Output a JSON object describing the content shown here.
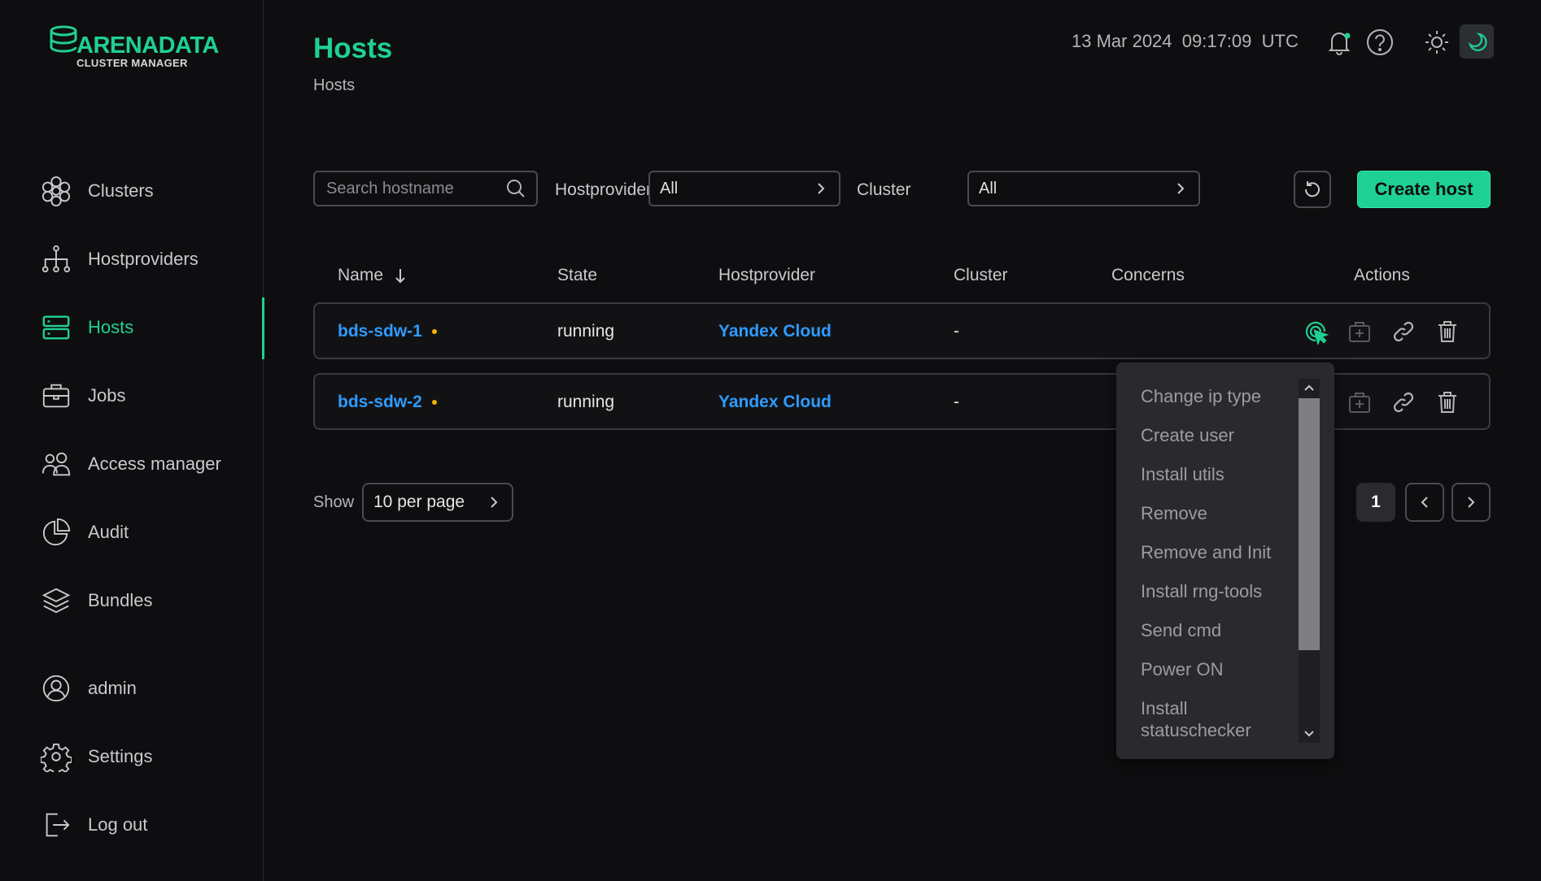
{
  "brand": {
    "name": "ARENADATA",
    "subtitle": "CLUSTER MANAGER",
    "accent": "#1fd095"
  },
  "sidebar": {
    "items": [
      {
        "label": "Clusters",
        "icon": "clusters-icon"
      },
      {
        "label": "Hostproviders",
        "icon": "hierarchy-icon"
      },
      {
        "label": "Hosts",
        "icon": "server-icon",
        "active": true
      },
      {
        "label": "Jobs",
        "icon": "briefcase-icon"
      },
      {
        "label": "Access manager",
        "icon": "users-icon"
      },
      {
        "label": "Audit",
        "icon": "pie-chart-icon"
      },
      {
        "label": "Bundles",
        "icon": "layers-icon"
      }
    ],
    "bottom": [
      {
        "label": "admin",
        "icon": "user-icon"
      },
      {
        "label": "Settings",
        "icon": "gear-icon"
      },
      {
        "label": "Log out",
        "icon": "logout-icon"
      }
    ]
  },
  "header": {
    "title": "Hosts",
    "breadcrumb": "Hosts",
    "date": "13 Mar 2024",
    "time": "09:17:09",
    "timezone": "UTC"
  },
  "filters": {
    "search_placeholder": "Search hostname",
    "hostprovider_label": "Hostprovider",
    "hostprovider_value": "All",
    "cluster_label": "Cluster",
    "cluster_value": "All",
    "create_label": "Create host"
  },
  "table": {
    "columns": [
      "Name",
      "State",
      "Hostprovider",
      "Cluster",
      "Concerns",
      "Actions"
    ],
    "rows": [
      {
        "name": "bds-sdw-1",
        "state": "running",
        "hostprovider": "Yandex Cloud",
        "cluster": "-"
      },
      {
        "name": "bds-sdw-2",
        "state": "running",
        "hostprovider": "Yandex Cloud",
        "cluster": "-"
      }
    ]
  },
  "pagination": {
    "show_label": "Show",
    "per_page": "10 per page",
    "current_page": "1"
  },
  "actions_menu": {
    "items": [
      "Change ip type",
      "Create user",
      "Install utils",
      "Remove",
      "Remove and Init",
      "Install rng-tools",
      "Send cmd",
      "Power ON",
      "Install statuschecker"
    ]
  }
}
